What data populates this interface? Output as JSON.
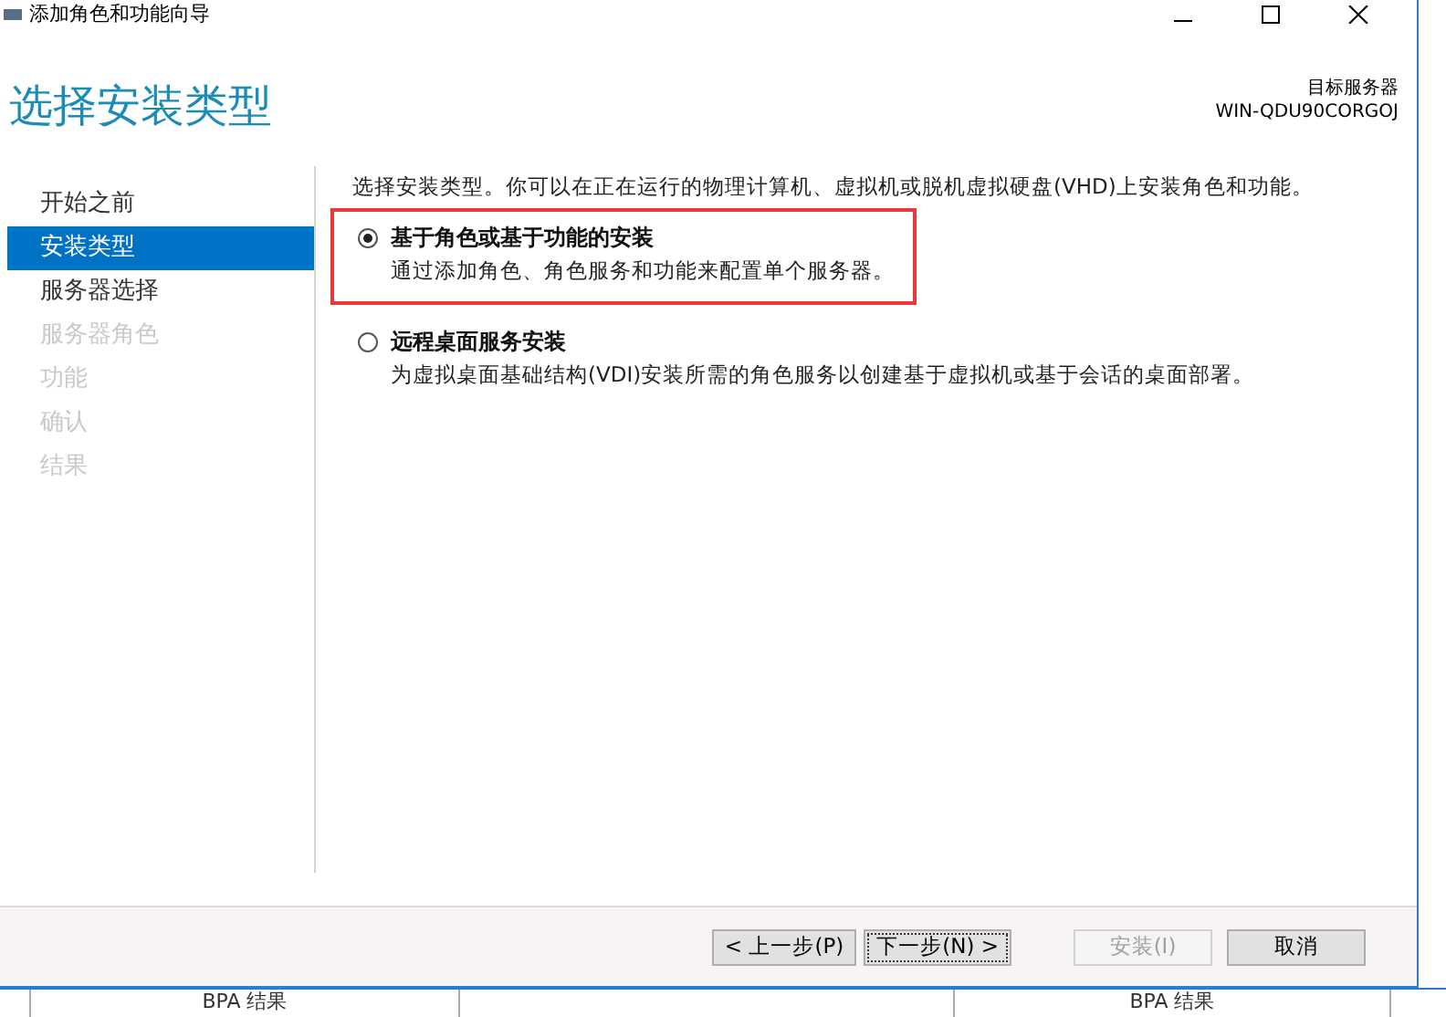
{
  "window": {
    "title": "添加角色和功能向导"
  },
  "header": {
    "title": "选择安装类型",
    "target_label": "目标服务器",
    "target_server": "WIN-QDU90CORGOJ"
  },
  "steps": [
    {
      "label": "开始之前",
      "selected": false,
      "disabled": false
    },
    {
      "label": "安装类型",
      "selected": true,
      "disabled": false
    },
    {
      "label": "服务器选择",
      "selected": false,
      "disabled": false
    },
    {
      "label": "服务器角色",
      "selected": false,
      "disabled": true
    },
    {
      "label": "功能",
      "selected": false,
      "disabled": true
    },
    {
      "label": "确认",
      "selected": false,
      "disabled": true
    },
    {
      "label": "结果",
      "selected": false,
      "disabled": true
    }
  ],
  "intro": "选择安装类型。你可以在正在运行的物理计算机、虚拟机或脱机虚拟硬盘(VHD)上安装角色和功能。",
  "options": [
    {
      "title": "基于角色或基于功能的安装",
      "description": "通过添加角色、角色服务和功能来配置单个服务器。",
      "selected": true,
      "highlighted": true
    },
    {
      "title": "远程桌面服务安装",
      "description": "为虚拟桌面基础结构(VDI)安装所需的角色服务以创建基于虚拟机或基于会话的桌面部署。",
      "selected": false,
      "highlighted": false
    }
  ],
  "buttons": [
    {
      "label": "< 上一步(P)",
      "disabled": false,
      "focused": false
    },
    {
      "label": "下一步(N) >",
      "disabled": false,
      "focused": true
    },
    {
      "label": "安装(I)",
      "disabled": true,
      "focused": false
    },
    {
      "label": "取消",
      "disabled": false,
      "focused": false
    }
  ],
  "background": {
    "texts": [
      "BPA 结果",
      "BPA 结果"
    ]
  }
}
